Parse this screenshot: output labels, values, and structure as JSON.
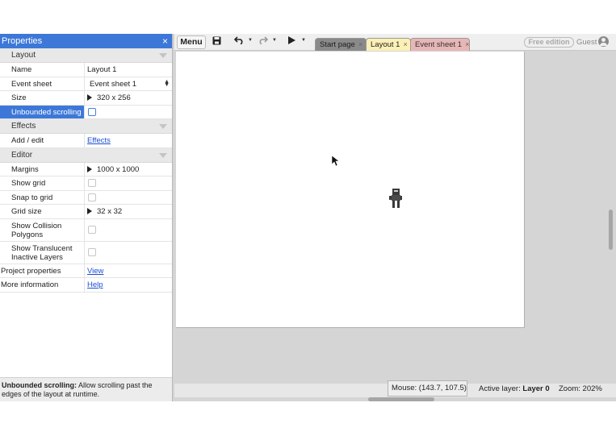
{
  "properties": {
    "title": "Properties",
    "close_icon": "×",
    "sections": {
      "layout": "Layout",
      "effects": "Effects",
      "editor": "Editor"
    },
    "layout_rows": {
      "name": {
        "label": "Name",
        "value": "Layout 1"
      },
      "event_sheet": {
        "label": "Event sheet",
        "value": "Event sheet 1"
      },
      "size": {
        "label": "Size",
        "value": "320 x 256"
      },
      "unbounded": {
        "label": "Unbounded scrolling",
        "checked": false
      }
    },
    "effects_rows": {
      "add_edit": {
        "label": "Add / edit",
        "link": "Effects"
      }
    },
    "editor_rows": {
      "margins": {
        "label": "Margins",
        "value": "1000 x 1000"
      },
      "show_grid": {
        "label": "Show grid",
        "checked": false
      },
      "snap_to_grid": {
        "label": "Snap to grid",
        "checked": false
      },
      "grid_size": {
        "label": "Grid size",
        "value": "32 x 32"
      },
      "show_collision": {
        "label": "Show Collision Polygons",
        "checked": false
      },
      "show_translucent": {
        "label": "Show Translucent Inactive Layers",
        "checked": false
      }
    },
    "project_properties": {
      "label": "Project properties",
      "link": "View"
    },
    "more_information": {
      "label": "More information",
      "link": "Help"
    },
    "help": {
      "title": "Unbounded scrolling:",
      "text": " Allow scrolling past the edges of the layout at runtime."
    }
  },
  "toolbar": {
    "menu_label": "Menu",
    "icons": [
      "save-icon",
      "undo-icon",
      "redo-icon",
      "play-icon"
    ],
    "tabs": [
      {
        "label": "Start page",
        "color": "#8a8a8a"
      },
      {
        "label": "Layout 1",
        "color": "#fbf0b6",
        "active": true
      },
      {
        "label": "Event sheet 1",
        "color": "#e8b6b6"
      }
    ],
    "tab_close": "×",
    "edition_badge": "Free edition",
    "user_label": "Guest"
  },
  "status": {
    "mouse": "Mouse: (143.7, 107.5)",
    "active_layer_label": "Active layer:",
    "active_layer_value": "Layer 0",
    "zoom": "Zoom: 202%"
  },
  "colors": {
    "accent": "#3d78d8",
    "canvas": "#ffffff",
    "workspace": "#d5d5d5"
  }
}
